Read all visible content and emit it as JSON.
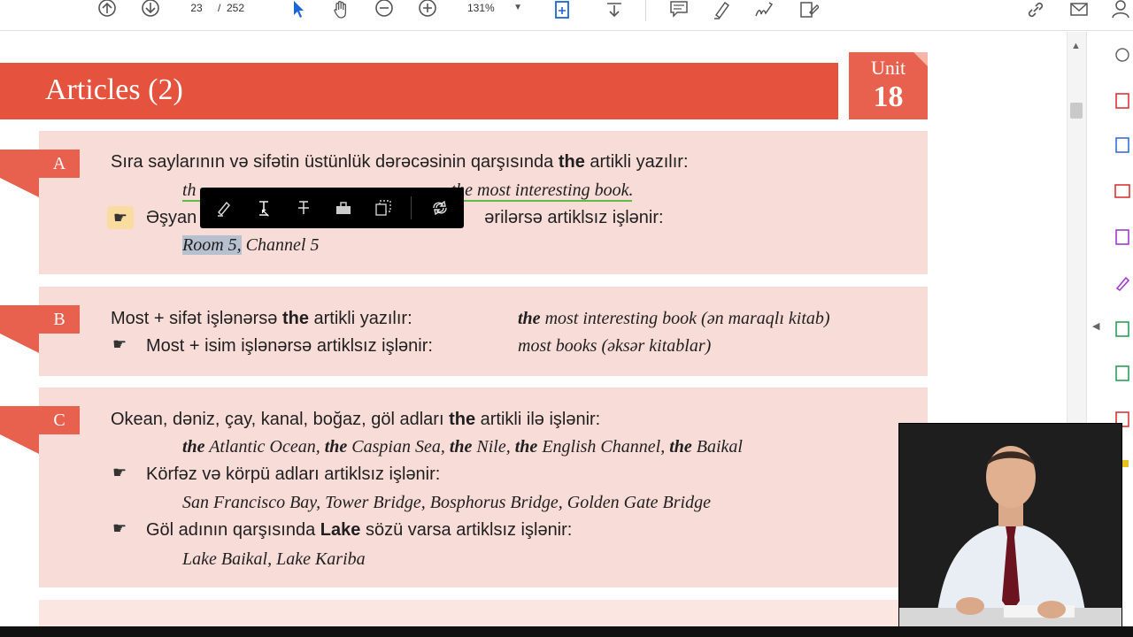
{
  "toolbar": {
    "page_current": "23",
    "page_separator": "/",
    "page_total": "252",
    "zoom": "131%",
    "icons": [
      "scroll-up-icon",
      "scroll-down-icon",
      "select-cursor-icon",
      "hand-tool-icon",
      "zoom-out-icon",
      "zoom-in-icon",
      "fit-page-icon",
      "download-icon",
      "comment-icon",
      "highlight-pen-icon",
      "signature-icon",
      "edit-pdf-icon",
      "link-icon",
      "email-icon",
      "account-icon"
    ]
  },
  "document": {
    "title": "Articles (2)",
    "unit_label": "Unit",
    "unit_number": "18",
    "section_a": {
      "letter": "A",
      "l1_pre": "Sıra saylarının və sifətin üstünlük dərəcəsinin qarşısında ",
      "l1_the": "the",
      "l1_post": " artikli yazılır:",
      "l2_a": "th",
      "l2_the": "the",
      "l2_b": " most interesting",
      "l2_c": " book.",
      "l3_a": "Əşyan",
      "l3_b": "ərilərsə artiklsız işlənir:",
      "l4_selected": "Room 5,",
      "l4_rest": " Channel 5"
    },
    "section_b": {
      "letter": "B",
      "l1_pre": "Most + sifət işlənərsə ",
      "l1_the": "the",
      "l1_post": " artikli yazılır:",
      "l1_ex_the": "the",
      "l1_ex": " most interesting book (ən maraqlı kitab)",
      "l2": "Most + isim işlənərsə artiklsız işlənir:",
      "l2_ex": "most books (əksər kitablar)"
    },
    "section_c": {
      "letter": "C",
      "l1_pre": "Okean, dəniz, çay, kanal, boğaz, göl adları ",
      "l1_the": "the",
      "l1_post": " artikli ilə işlənir:",
      "l2_the": "the",
      "l2_a": " Atlantic Ocean, ",
      "l2_b": " Caspian Sea, ",
      "l2_c": " Nile, ",
      "l2_d": " English Channel, ",
      "l2_e": " Baikal",
      "l3": "Körfəz və körpü adları artiklsız işlənir:",
      "l4": "San Francisco Bay, Tower Bridge, Bosphorus Bridge, Golden Gate Bridge",
      "l5_pre": "Göl adının qarşısında ",
      "l5_lake": "Lake",
      "l5_post": " sözü varsa artiklsız işlənir:",
      "l6": "Lake Baikal, Lake Kariba"
    }
  },
  "floating_toolbar": {
    "icons": [
      "highlight-icon",
      "underline-icon",
      "strikethrough-icon",
      "redact-icon",
      "copy-icon",
      "more-icon"
    ]
  },
  "right_panel": {
    "icons": [
      "export-pdf-icon",
      "create-pdf-icon",
      "edit-pdf-icon",
      "combine-files-icon",
      "organize-pages-icon",
      "fill-sign-icon",
      "protect-icon",
      "optimize-icon",
      "compress-icon",
      "more-tools-icon"
    ]
  },
  "colors": {
    "title_bar": "#e5533f",
    "section_bg": "#f8dcd8",
    "section_flag": "#e8604e"
  }
}
